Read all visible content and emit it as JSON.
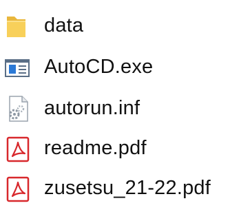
{
  "files": [
    {
      "name": "data",
      "icon": "folder-icon"
    },
    {
      "name": "AutoCD.exe",
      "icon": "application-icon"
    },
    {
      "name": "autorun.inf",
      "icon": "settings-file-icon"
    },
    {
      "name": "readme.pdf",
      "icon": "pdf-icon"
    },
    {
      "name": "zusetsu_21-22.pdf",
      "icon": "pdf-icon"
    }
  ],
  "colors": {
    "folder": "#f8d05a",
    "folder_shade": "#e9b73c",
    "exe_frame": "#5a6e86",
    "exe_accent": "#2b79d6",
    "pdf_red": "#d8282c",
    "text": "#111111"
  }
}
